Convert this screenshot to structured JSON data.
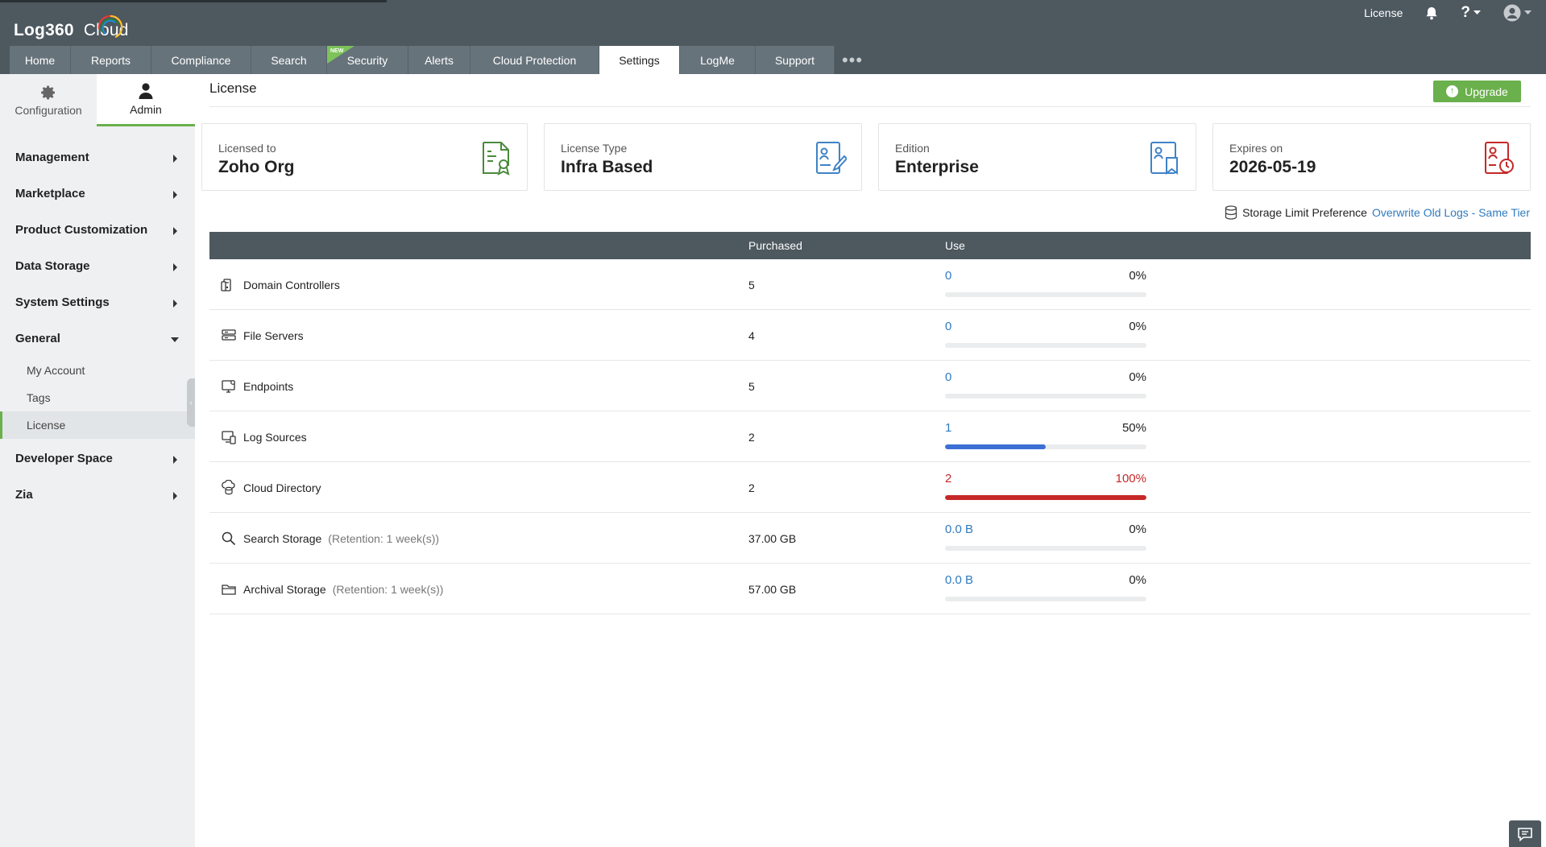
{
  "app": {
    "logo_main": "Log360",
    "logo_sub": "Cloud"
  },
  "header_right": {
    "license_link": "License",
    "notifications_icon": "bell-icon",
    "help_icon": "question-icon",
    "user_icon": "user-circle-icon"
  },
  "tabs": [
    {
      "label": "Home",
      "w": 76
    },
    {
      "label": "Reports",
      "w": 100
    },
    {
      "label": "Compliance",
      "w": 124
    },
    {
      "label": "Search",
      "w": 94
    },
    {
      "label": "Security",
      "w": 101,
      "badge": "NEW"
    },
    {
      "label": "Alerts",
      "w": 77
    },
    {
      "label": "Cloud Protection",
      "w": 160
    },
    {
      "label": "Settings",
      "w": 100,
      "active": true
    },
    {
      "label": "LogMe",
      "w": 94
    },
    {
      "label": "Support",
      "w": 98
    }
  ],
  "sidebar": {
    "top_tabs": [
      {
        "label": "Configuration",
        "icon": "gear-icon"
      },
      {
        "label": "Admin",
        "icon": "user-icon",
        "active": true
      }
    ],
    "menu": [
      {
        "label": "Management"
      },
      {
        "label": "Marketplace"
      },
      {
        "label": "Product Customization"
      },
      {
        "label": "Data Storage"
      },
      {
        "label": "System Settings"
      },
      {
        "label": "General",
        "expanded": true
      }
    ],
    "general_sub": [
      {
        "label": "My Account"
      },
      {
        "label": "Tags"
      },
      {
        "label": "License",
        "active": true
      }
    ],
    "menu_after": [
      {
        "label": "Developer Space"
      },
      {
        "label": "Zia"
      }
    ]
  },
  "main": {
    "title": "License",
    "upgrade_label": "Upgrade",
    "cards": [
      {
        "label": "Licensed to",
        "value": "Zoho Org",
        "icon": "certificate-icon",
        "color": "#4a8a3c"
      },
      {
        "label": "License Type",
        "value": "Infra Based",
        "icon": "id-card-brush-icon",
        "color": "#3f83c6"
      },
      {
        "label": "Edition",
        "value": "Enterprise",
        "icon": "id-card-bookmark-icon",
        "color": "#3f83c6"
      },
      {
        "label": "Expires on",
        "value": "2026-05-19",
        "icon": "id-card-clock-icon",
        "color": "#c62828"
      }
    ],
    "storage_pref": {
      "label": "Storage Limit Preference",
      "value": "Overwrite Old Logs - Same Tier"
    },
    "table": {
      "headers": [
        "",
        "Purchased",
        "Use"
      ],
      "rows": [
        {
          "name": "Domain Controllers",
          "icon": "domain-controller-icon",
          "purchased": "5",
          "used": "0",
          "percent": "0%",
          "fraction": 0
        },
        {
          "name": "File Servers",
          "icon": "server-icon",
          "purchased": "4",
          "used": "0",
          "percent": "0%",
          "fraction": 0
        },
        {
          "name": "Endpoints",
          "icon": "monitor-icon",
          "purchased": "5",
          "used": "0",
          "percent": "0%",
          "fraction": 0
        },
        {
          "name": "Log Sources",
          "icon": "log-source-icon",
          "purchased": "2",
          "used": "1",
          "percent": "50%",
          "fraction": 0.5
        },
        {
          "name": "Cloud Directory",
          "icon": "cloud-directory-icon",
          "purchased": "2",
          "used": "2",
          "percent": "100%",
          "fraction": 1.0,
          "full": true
        },
        {
          "name": "Search Storage",
          "retention": "(Retention: 1 week(s))",
          "icon": "search-icon",
          "purchased": "37.00 GB",
          "used": "0.0 B",
          "percent": "0%",
          "fraction": 0
        },
        {
          "name": "Archival Storage",
          "retention": "(Retention: 1 week(s))",
          "icon": "folder-icon",
          "purchased": "57.00 GB",
          "used": "0.0 B",
          "percent": "0%",
          "fraction": 0
        }
      ]
    }
  },
  "chat_icon": "chat-icon"
}
